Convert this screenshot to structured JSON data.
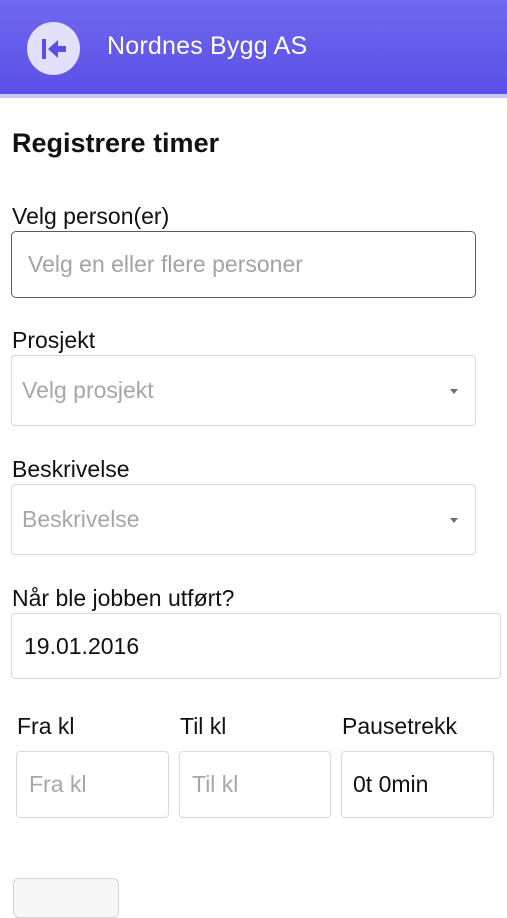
{
  "header": {
    "title": "Nordnes Bygg AS",
    "back_icon": "back-arrow-icon",
    "gradient": [
      "#7068f0",
      "#5a4fe6"
    ]
  },
  "form": {
    "title": "Registrere timer",
    "persons": {
      "label": "Velg person(er)",
      "placeholder": "Velg en eller flere personer"
    },
    "project": {
      "label": "Prosjekt",
      "placeholder": "Velg prosjekt"
    },
    "description": {
      "label": "Beskrivelse",
      "placeholder": "Beskrivelse"
    },
    "date": {
      "label": "Når ble jobben utført?",
      "value": "19.01.2016"
    },
    "from": {
      "label": "Fra kl",
      "placeholder": "Fra kl"
    },
    "to": {
      "label": "Til kl",
      "placeholder": "Til kl"
    },
    "break": {
      "label": "Pausetrekk",
      "value": "0t 0min"
    }
  }
}
